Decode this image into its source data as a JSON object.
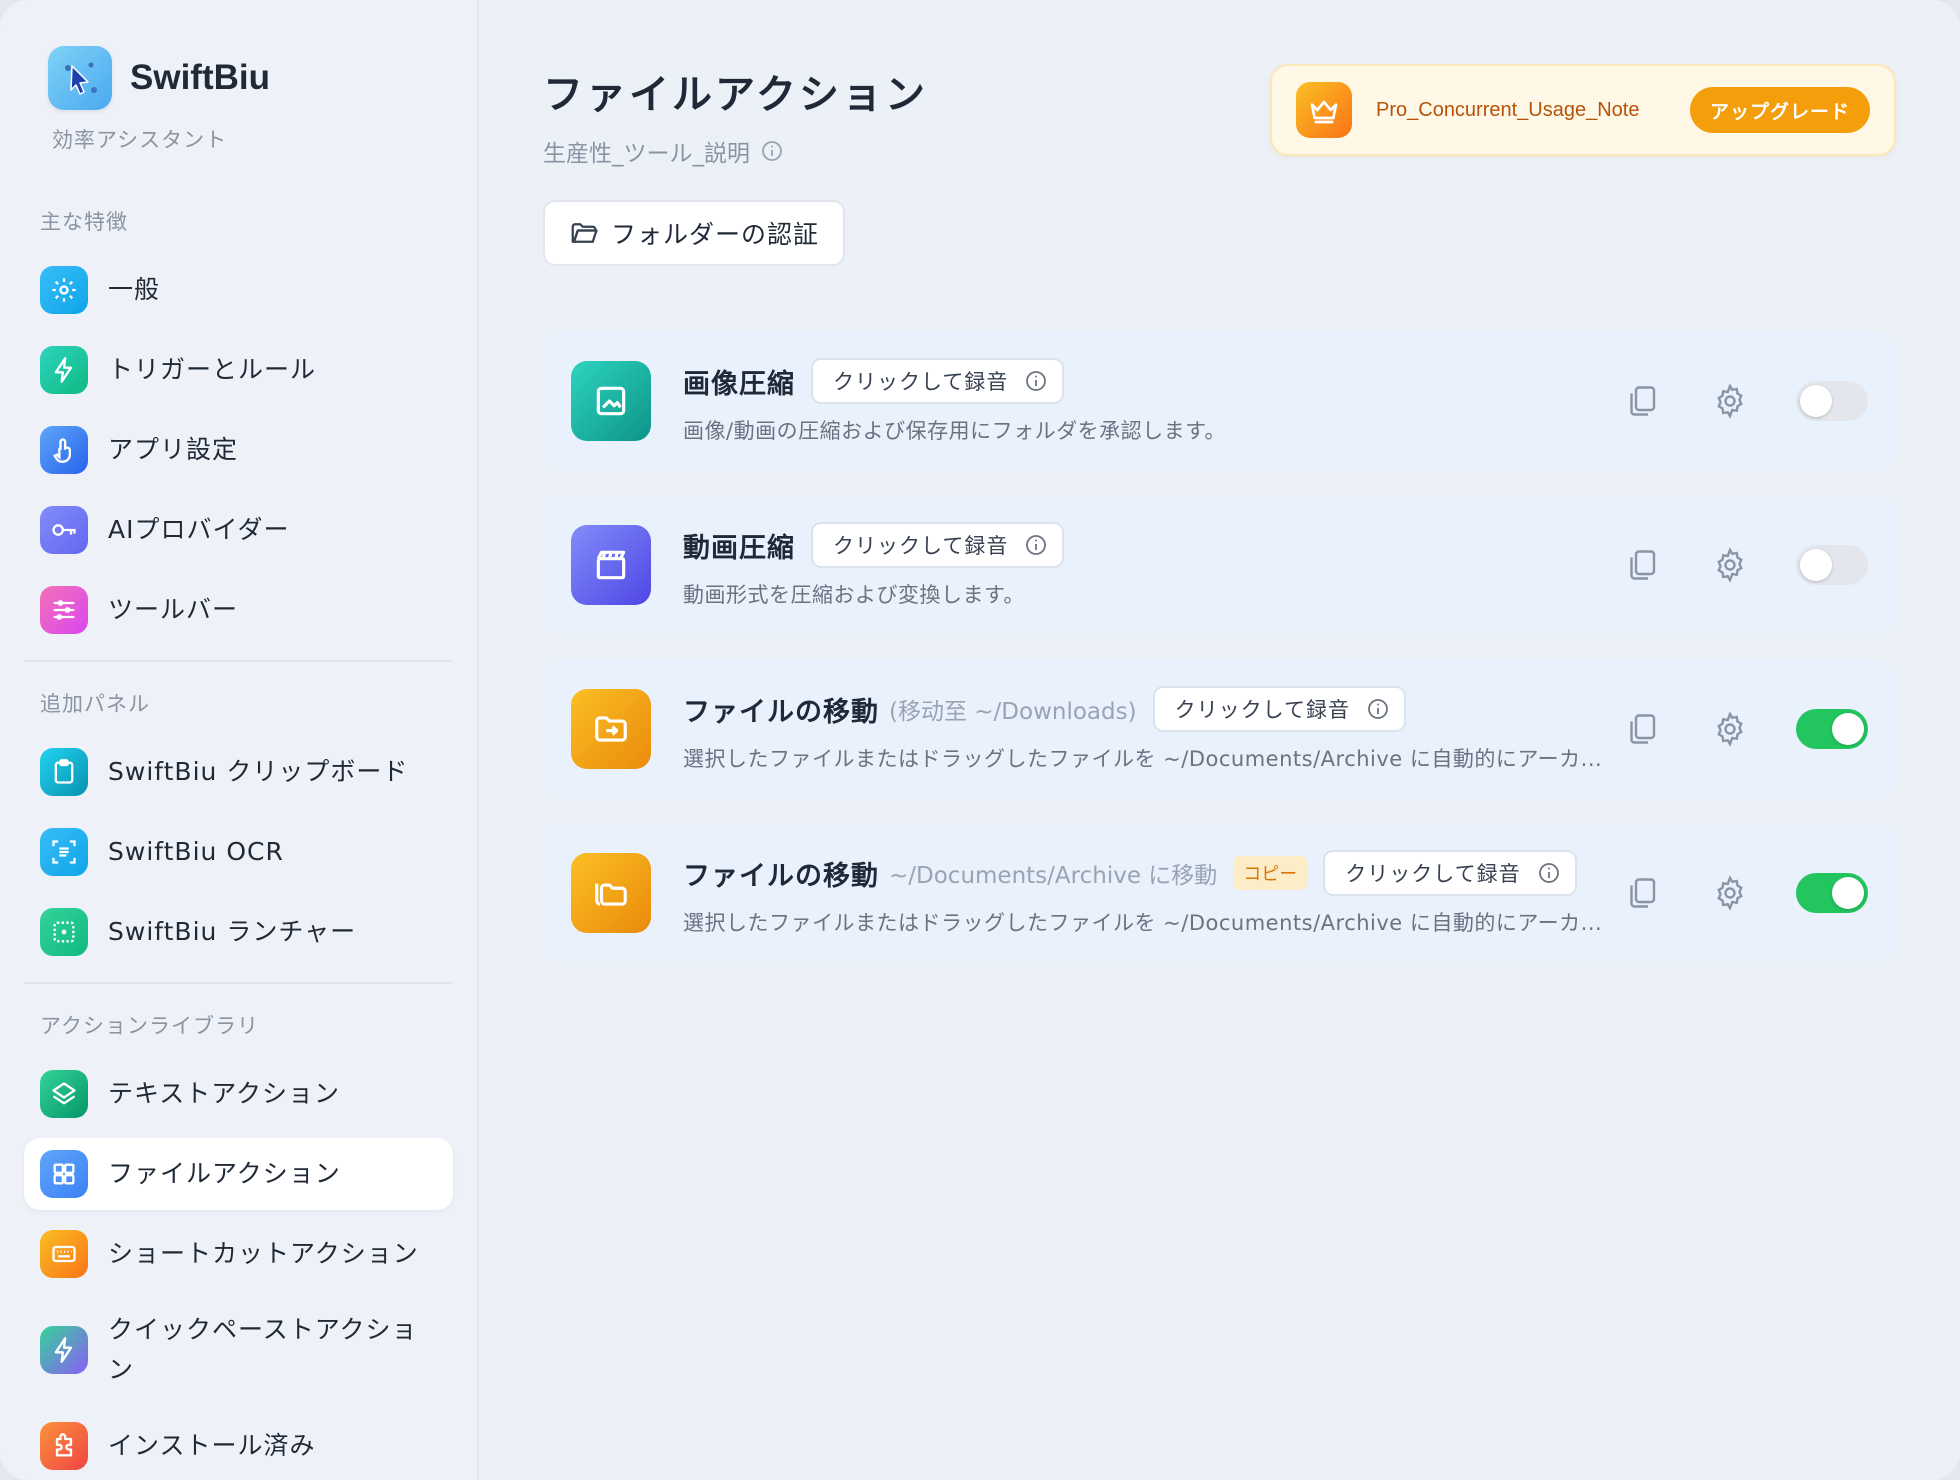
{
  "app": {
    "name": "SwiftBiu",
    "subtitle": "効率アシスタント"
  },
  "sidebar": {
    "sections": [
      {
        "title": "主な特徴",
        "items": [
          {
            "label": "一般",
            "icon": "gear-icon",
            "color": "#0ea5e9"
          },
          {
            "label": "トリガーとルール",
            "icon": "lightning-icon",
            "color": "#14b8a6"
          },
          {
            "label": "アプリ設定",
            "icon": "pointer-hand-icon",
            "color": "#3b82f6"
          },
          {
            "label": "AIプロバイダー",
            "icon": "key-icon",
            "color": "#6366f1"
          },
          {
            "label": "ツールバー",
            "icon": "sliders-icon",
            "color": "#d946ef"
          }
        ]
      },
      {
        "title": "追加パネル",
        "items": [
          {
            "label": "SwiftBiu クリップボード",
            "icon": "clipboard-icon",
            "color": "#06b6d4"
          },
          {
            "label": "SwiftBiu OCR",
            "icon": "ocr-scan-icon",
            "color": "#0ea5e9"
          },
          {
            "label": "SwiftBiu ランチャー",
            "icon": "launcher-icon",
            "color": "#10b981"
          }
        ]
      },
      {
        "title": "アクションライブラリ",
        "items": [
          {
            "label": "テキストアクション",
            "icon": "layers-icon",
            "color": "#10b981"
          },
          {
            "label": "ファイルアクション",
            "icon": "grid-icon",
            "color": "#3b82f6",
            "active": true
          },
          {
            "label": "ショートカットアクション",
            "icon": "keyboard-icon",
            "color": "#f59e0b"
          },
          {
            "label": "クイックペーストアクション",
            "icon": "bolt-icon",
            "color": "#8b5cf6"
          },
          {
            "label": "インストール済み",
            "icon": "puzzle-icon",
            "color": "#f97316"
          }
        ]
      }
    ]
  },
  "main": {
    "title": "ファイルアクション",
    "subtitle": "生産性_ツール_説明",
    "pro_banner": {
      "text": "Pro_Concurrent_Usage_Note",
      "button": "アップグレード"
    },
    "folder_button": "フォルダーの認証",
    "cards": [
      {
        "title": "画像圧縮",
        "extra": "",
        "tag": "",
        "record": "クリックして録音",
        "desc": "画像/動画の圧縮および保存用にフォルダを承認します。",
        "icon": "image-icon",
        "enabled": false
      },
      {
        "title": "動画圧縮",
        "extra": "",
        "tag": "",
        "record": "クリックして録音",
        "desc": "動画形式を圧縮および変換します。",
        "icon": "film-icon",
        "enabled": false
      },
      {
        "title": "ファイルの移動",
        "extra": "(移动至 ~/Downloads)",
        "tag": "",
        "record": "クリックして録音",
        "desc": "選択したファイルまたはドラッグしたファイルを ~/Documents/Archive に自動的にアーカ...",
        "icon": "folder-move-icon",
        "enabled": true
      },
      {
        "title": "ファイルの移動",
        "extra": "~/Documents/Archive に移動",
        "tag": "コピー",
        "record": "クリックして録音",
        "desc": "選択したファイルまたはドラッグしたファイルを ~/Documents/Archive に自動的にアーカ...",
        "icon": "folders-icon",
        "enabled": true
      }
    ]
  }
}
